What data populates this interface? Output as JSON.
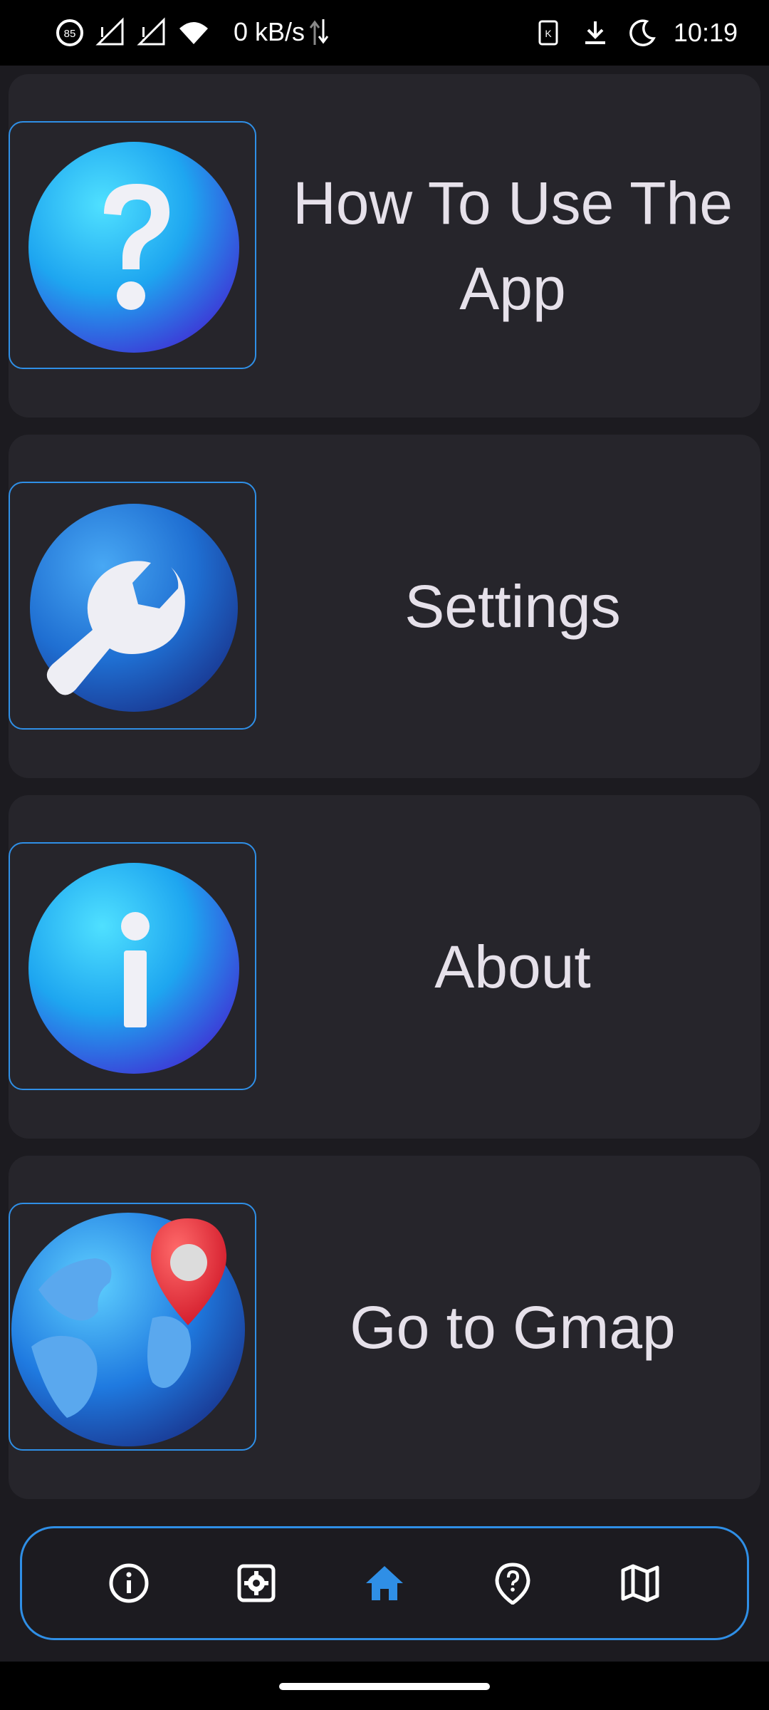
{
  "status_bar": {
    "battery_level": "85",
    "net_speed": "0 kB/s",
    "time": "10:19",
    "icons": [
      "battery-saver-icon",
      "signal-no-data-icon",
      "signal-no-data-icon",
      "wifi-icon",
      "data-arrows-icon",
      "sim-icon",
      "download-icon",
      "dnd-moon-icon"
    ]
  },
  "menu": {
    "items": [
      {
        "label": "How To Use The App",
        "icon": "question-icon"
      },
      {
        "label": "Settings",
        "icon": "wrench-icon"
      },
      {
        "label": "About",
        "icon": "info-icon"
      },
      {
        "label": "Go to Gmap",
        "icon": "globe-pin-icon"
      }
    ]
  },
  "bottom_nav": {
    "items": [
      {
        "icon": "info-icon",
        "active": false
      },
      {
        "icon": "settings-icon",
        "active": false
      },
      {
        "icon": "home-icon",
        "active": true
      },
      {
        "icon": "location-help-icon",
        "active": false
      },
      {
        "icon": "map-icon",
        "active": false
      }
    ],
    "active_color": "#2f8fe6",
    "inactive_color": "#ffffff"
  },
  "colors": {
    "accent": "#2f8fe6",
    "card_bg": "#26252b",
    "page_bg": "#1c1b20",
    "text": "#e6e1ea"
  }
}
